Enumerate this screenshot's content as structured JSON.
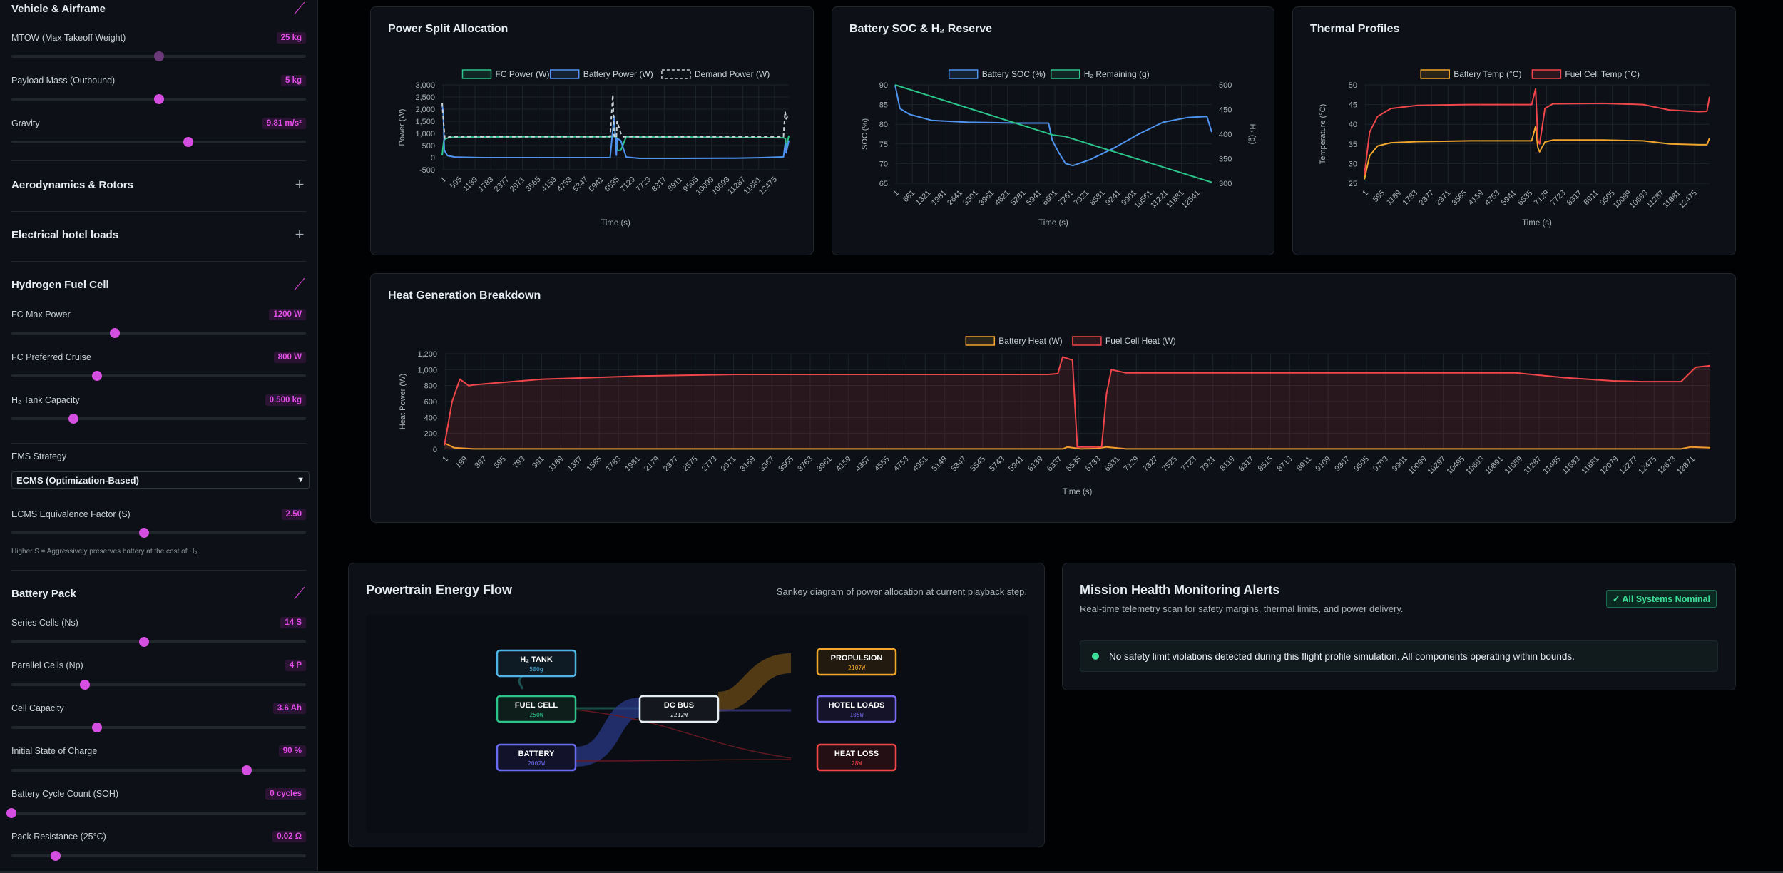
{
  "sidebar": {
    "sections": {
      "vehicle": "Vehicle & Airframe",
      "aero": "Aerodynamics & Rotors",
      "electrical": "Electrical hotel loads",
      "fuelcell": "Hydrogen Fuel Cell",
      "battery": "Battery Pack"
    },
    "params": {
      "mtow": {
        "label": "MTOW (Max Takeoff Weight)",
        "value": "25 kg",
        "level": 0.5
      },
      "payload": {
        "label": "Payload Mass (Outbound)",
        "value": "5 kg",
        "level": 0.5
      },
      "gravity": {
        "label": "Gravity",
        "value": "9.81 m/s²",
        "level": 0.6
      },
      "fc_max": {
        "label": "FC Max Power",
        "value": "1200 W",
        "level": 0.35
      },
      "fc_cruise": {
        "label": "FC Preferred Cruise",
        "value": "800 W",
        "level": 0.29
      },
      "h2_tank": {
        "label": "H₂ Tank Capacity",
        "value": "0.500 kg",
        "level": 0.21
      },
      "ecms_s": {
        "label": "ECMS Equivalence Factor (S)",
        "value": "2.50",
        "level": 0.45
      },
      "series": {
        "label": "Series Cells (Ns)",
        "value": "14 S",
        "level": 0.45
      },
      "parallel": {
        "label": "Parallel Cells (Np)",
        "value": "4 P",
        "level": 0.25
      },
      "capacity": {
        "label": "Cell Capacity",
        "value": "3.6 Ah",
        "level": 0.29
      },
      "init_soc": {
        "label": "Initial State of Charge",
        "value": "90 %",
        "level": 0.8
      },
      "cycles": {
        "label": "Battery Cycle Count (SOH)",
        "value": "0 cycles",
        "level": 0.0
      },
      "resistance": {
        "label": "Pack Resistance (25°C)",
        "value": "0.02 Ω",
        "level": 0.15
      }
    },
    "ems": {
      "label": "EMS Strategy",
      "selected": "ECMS (Optimization-Based)",
      "hint": "Higher S = Aggressively preserves battery at the cost of H₂"
    }
  },
  "charts": {
    "power": {
      "title": "Power Split Allocation"
    },
    "soc": {
      "title": "Battery SOC & H₂ Reserve"
    },
    "thermal": {
      "title": "Thermal Profiles"
    },
    "heat": {
      "title": "Heat Generation Breakdown"
    }
  },
  "chart_data": [
    {
      "type": "line",
      "title": "Power Split Allocation",
      "xlabel": "Time (s)",
      "ylabel": "Power (W)",
      "ylim": [
        -500,
        3000
      ],
      "yticks": [
        "3,000",
        "2,500",
        "2,000",
        "1,500",
        "1,000",
        "500",
        "0",
        "-500"
      ],
      "x_ticks": [
        "1",
        "595",
        "1189",
        "1783",
        "2377",
        "2971",
        "3565",
        "4159",
        "4753",
        "5347",
        "5941",
        "6535",
        "7129",
        "7723",
        "8317",
        "8911",
        "9505",
        "10099",
        "10693",
        "11287",
        "11881",
        "12475"
      ],
      "legend": "top",
      "series": [
        {
          "name": "FC Power (W)",
          "color": "#2bc48a",
          "x": [
            1,
            60,
            120,
            300,
            1500,
            3000,
            5000,
            6300,
            6535,
            6560,
            6700,
            6900,
            7129,
            7300,
            9000,
            11000,
            12800,
            12875,
            12900,
            13000
          ],
          "y": [
            100,
            700,
            780,
            840,
            850,
            860,
            860,
            860,
            880,
            300,
            300,
            860,
            860,
            850,
            850,
            830,
            820,
            780,
            400,
            900
          ]
        },
        {
          "name": "Battery Power (W)",
          "color": "#4f94f0",
          "x": [
            1,
            40,
            80,
            200,
            500,
            1500,
            3000,
            5000,
            6300,
            6450,
            6535,
            6560,
            6700,
            6900,
            7129,
            7400,
            9000,
            11000,
            12000,
            12800,
            12870,
            12900,
            13000
          ],
          "y": [
            2150,
            1900,
            300,
            80,
            20,
            0,
            0,
            0,
            0,
            1700,
            100,
            800,
            700,
            20,
            0,
            -30,
            -30,
            -20,
            0,
            30,
            600,
            200,
            700
          ]
        },
        {
          "name": "Demand Power (W)",
          "color": "#c9d1d9",
          "dashed": true,
          "x": [
            1,
            40,
            100,
            300,
            1000,
            3000,
            6300,
            6400,
            6450,
            6535,
            6560,
            6700,
            6800,
            7129,
            9000,
            12800,
            12860,
            12900,
            13000
          ],
          "y": [
            2250,
            1600,
            800,
            860,
            860,
            860,
            860,
            2600,
            900,
            800,
            1500,
            1000,
            860,
            860,
            860,
            860,
            1900,
            1600,
            1800
          ]
        }
      ]
    },
    {
      "type": "line",
      "title": "Battery SOC & H₂ Reserve",
      "xlabel": "Time (s)",
      "ylabel": "SOC (%)",
      "y2label": "H₂ (g)",
      "ylim": [
        65,
        90
      ],
      "y2lim": [
        300,
        500
      ],
      "yticks": [
        "90",
        "85",
        "80",
        "75",
        "70",
        "65"
      ],
      "y2ticks": [
        "500",
        "450",
        "400",
        "350",
        "300"
      ],
      "x_ticks": [
        "1",
        "661",
        "1321",
        "1981",
        "2641",
        "3301",
        "3961",
        "4621",
        "5281",
        "5941",
        "6601",
        "7261",
        "7921",
        "8581",
        "9241",
        "9901",
        "10561",
        "11221",
        "11881",
        "12541"
      ],
      "legend": "top",
      "series": [
        {
          "name": "Battery SOC (%)",
          "color": "#4f94f0",
          "x": [
            1,
            200,
            600,
            1500,
            3000,
            5000,
            6300,
            6450,
            6700,
            7000,
            7300,
            8000,
            9000,
            10000,
            11000,
            12000,
            12800,
            13000
          ],
          "y": [
            90,
            84,
            82.5,
            81,
            80.5,
            80.3,
            80.3,
            76,
            73,
            70,
            69.5,
            71,
            74,
            77.5,
            80.5,
            81.7,
            82,
            78
          ]
        },
        {
          "name": "H₂ Remaining (g)",
          "color": "#2bc48a",
          "x": [
            1,
            6500,
            7000,
            13000
          ],
          "y": [
            500,
            398,
            395,
            302
          ]
        }
      ]
    },
    {
      "type": "line",
      "title": "Thermal Profiles",
      "xlabel": "Time (s)",
      "ylabel": "Temperature (°C)",
      "ylim": [
        25,
        50
      ],
      "yticks": [
        "50",
        "45",
        "40",
        "35",
        "30",
        "25"
      ],
      "x_ticks": [
        "1",
        "595",
        "1189",
        "1783",
        "2377",
        "2971",
        "3565",
        "4159",
        "4753",
        "5941",
        "6535",
        "7129",
        "7723",
        "8317",
        "8911",
        "9505",
        "10099",
        "10693",
        "11287",
        "11881",
        "12475"
      ],
      "legend": "top",
      "series": [
        {
          "name": "Battery Temp (°C)",
          "color": "#f0a62d",
          "x": [
            1,
            200,
            500,
            1000,
            2000,
            4000,
            6300,
            6450,
            6535,
            6600,
            6800,
            7100,
            9000,
            10500,
            11500,
            12600,
            12900,
            13000
          ],
          "y": [
            26,
            32,
            34.5,
            35.3,
            35.6,
            35.8,
            35.8,
            39.5,
            34,
            33,
            35.5,
            36,
            36,
            35.8,
            35,
            34.8,
            34.8,
            36.5
          ]
        },
        {
          "name": "Fuel Cell Temp (°C)",
          "color": "#f0464a",
          "x": [
            1,
            200,
            500,
            1000,
            2000,
            4000,
            6300,
            6450,
            6535,
            6600,
            6800,
            7100,
            9000,
            10500,
            11500,
            12600,
            12900,
            13000
          ],
          "y": [
            27,
            38,
            42,
            44,
            44.8,
            45,
            45,
            49,
            36,
            35,
            44,
            45.2,
            45.3,
            45,
            43.6,
            43.2,
            43.3,
            47
          ]
        }
      ]
    },
    {
      "type": "area",
      "title": "Heat Generation Breakdown",
      "xlabel": "Time (s)",
      "ylabel": "Heat Power (W)",
      "ylim": [
        0,
        1200
      ],
      "yticks": [
        "1,200",
        "1,000",
        "800",
        "600",
        "400",
        "200",
        "0"
      ],
      "x_ticks": [
        "1",
        "199",
        "397",
        "595",
        "793",
        "991",
        "1189",
        "1387",
        "1585",
        "1783",
        "1981",
        "2179",
        "2377",
        "2575",
        "2773",
        "2971",
        "3169",
        "3367",
        "3565",
        "3763",
        "3961",
        "4159",
        "4357",
        "4555",
        "4753",
        "4951",
        "5149",
        "5347",
        "5545",
        "5743",
        "5941",
        "6139",
        "6337",
        "6535",
        "6733",
        "6931",
        "7129",
        "7327",
        "7525",
        "7723",
        "7921",
        "8119",
        "8317",
        "8515",
        "8713",
        "8911",
        "9109",
        "9307",
        "9505",
        "9703",
        "9901",
        "10099",
        "10297",
        "10495",
        "10693",
        "10891",
        "11089",
        "11287",
        "11485",
        "11683",
        "11881",
        "12079",
        "12277",
        "12475",
        "12673",
        "12871"
      ],
      "legend": "top",
      "series": [
        {
          "name": "Battery Heat (W)",
          "color": "#f0a62d",
          "x": [
            1,
            100,
            300,
            1000,
            6000,
            6350,
            6400,
            6450,
            6535,
            6700,
            6800,
            7000,
            10000,
            12700,
            12800,
            13000
          ],
          "y": [
            80,
            20,
            5,
            5,
            5,
            5,
            30,
            20,
            5,
            10,
            30,
            5,
            5,
            5,
            30,
            20
          ]
        },
        {
          "name": "Fuel Cell Heat (W)",
          "color": "#f0464a",
          "x": [
            1,
            80,
            160,
            250,
            300,
            500,
            1000,
            2000,
            3000,
            5000,
            6200,
            6300,
            6350,
            6450,
            6500,
            6550,
            6600,
            6750,
            6800,
            6850,
            7000,
            8000,
            9000,
            10000,
            11000,
            11500,
            12000,
            12300,
            12700,
            12850,
            13000
          ],
          "y": [
            50,
            600,
            880,
            800,
            810,
            830,
            880,
            920,
            940,
            940,
            940,
            950,
            1160,
            1120,
            30,
            30,
            30,
            30,
            700,
            1000,
            960,
            960,
            960,
            960,
            960,
            900,
            860,
            850,
            850,
            1030,
            1050
          ]
        }
      ]
    }
  ],
  "sankey": {
    "title": "Powertrain Energy Flow",
    "subtitle": "Sankey diagram of power allocation at current playback step.",
    "nodes": {
      "h2tank": {
        "label": "H₂ TANK",
        "value": "500g",
        "color": "#4fb3e8"
      },
      "fuelcell": {
        "label": "FUEL CELL",
        "value": "250W",
        "color": "#2bc48a"
      },
      "battery": {
        "label": "BATTERY",
        "value": "2002W",
        "color": "#6a6cf0"
      },
      "dcbus": {
        "label": "DC BUS",
        "value": "2212W",
        "color": "#e6edf3"
      },
      "propulsion": {
        "label": "PROPULSION",
        "value": "2107W",
        "color": "#f0a62d"
      },
      "hotel": {
        "label": "HOTEL LOADS",
        "value": "105W",
        "color": "#7a6cf0"
      },
      "heatloss": {
        "label": "HEAT LOSS",
        "value": "28W",
        "color": "#f0464a"
      }
    }
  },
  "alerts": {
    "title": "Mission Health Monitoring Alerts",
    "subtitle": "Real-time telemetry scan for safety margins, thermal limits, and power delivery.",
    "badge": "✓ All Systems Nominal",
    "message": "No safety limit violations detected during this flight profile simulation. All components operating within bounds."
  }
}
